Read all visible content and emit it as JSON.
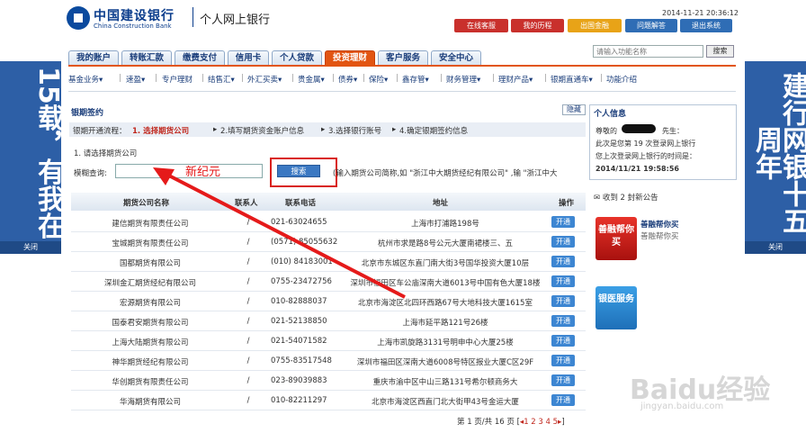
{
  "left_banner": {
    "text": "15载，有我在",
    "close": "关闭"
  },
  "right_banner": {
    "text": "建行网银十五周年",
    "close": "关闭"
  },
  "header": {
    "logo_cn": "中国建设银行",
    "logo_en": "China Construction Bank",
    "product": "个人网上银行",
    "datetime": "2014-11-21 20:36:12",
    "buttons": [
      "在线客服",
      "我的历程",
      "出国金融",
      "问题解答",
      "退出系统"
    ]
  },
  "tabs": [
    "我的账户",
    "转账汇款",
    "缴费支付",
    "信用卡",
    "个人贷款",
    "投资理财",
    "客户服务",
    "安全中心"
  ],
  "active_tab": "投资理财",
  "search": {
    "placeholder": "请输入功能名称",
    "button": "搜索"
  },
  "subnav": [
    "基金业务▾",
    "速盈▾",
    "专户理财",
    "结售汇▾",
    "外汇买卖▾",
    "贵金属▾",
    "债券▾",
    "保险▾",
    "鑫存管▾",
    "财务管理▾",
    "理财产品▾",
    "银期直通车▾",
    "功能介绍"
  ],
  "section_title": "银期签约",
  "hide_label": "隐藏",
  "steps": {
    "prefix": "银期开通流程：",
    "items": [
      "1. 选择期货公司",
      "2.填写期货资金账户信息",
      "3.选择银行账号",
      "4.确定银期签约信息"
    ]
  },
  "step1_title": "1. 请选择期货公司",
  "fuzzy": {
    "label": "模糊查询:",
    "button": "搜索",
    "hint": "(输入期货公司简称,如 \"浙江中大期货经纪有限公司\" ,输 \"浙江中大"
  },
  "annotation": "新纪元",
  "table": {
    "headers": [
      "期货公司名称",
      "联系人",
      "联系电话",
      "地址",
      "操作"
    ],
    "rows": [
      {
        "name": "建信期货有限责任公司",
        "contact": "/",
        "phone": "021-63024655",
        "address": "上海市打浦路198号",
        "action": "开通"
      },
      {
        "name": "宝城期货有限责任公司",
        "contact": "/",
        "phone": "(0571) 85055632",
        "address": "杭州市求是路8号公元大厦南裙楼三、五",
        "action": "开通"
      },
      {
        "name": "国都期货有限公司",
        "contact": "/",
        "phone": "(010) 84183001",
        "address": "北京市东城区东直门南大街3号国华投资大厦10层",
        "action": "开通"
      },
      {
        "name": "深圳金汇期货经纪有限公司",
        "contact": "/",
        "phone": "0755-23472756",
        "address": "深圳市福田区车公庙深南大道6013号中国有色大厦18楼",
        "action": "开通"
      },
      {
        "name": "宏源期货有限公司",
        "contact": "/",
        "phone": "010-82888037",
        "address": "北京市海淀区北四环西路67号大地科技大厦1615室",
        "action": "开通"
      },
      {
        "name": "国泰君安期货有限公司",
        "contact": "/",
        "phone": "021-52138850",
        "address": "上海市延平路121号26楼",
        "action": "开通"
      },
      {
        "name": "上海大陆期货有限公司",
        "contact": "/",
        "phone": "021-54071582",
        "address": "上海市凯旋路3131号明申中心大厦25楼",
        "action": "开通"
      },
      {
        "name": "神华期货经纪有限公司",
        "contact": "/",
        "phone": "0755-83517548",
        "address": "深圳市福田区深南大道6008号特区报业大厦C区29F",
        "action": "开通"
      },
      {
        "name": "华创期货有限责任公司",
        "contact": "/",
        "phone": "023-89039883",
        "address": "重庆市渝中区中山三路131号希尔顿商务大",
        "action": "开通"
      },
      {
        "name": "华海期货有限公司",
        "contact": "/",
        "phone": "010-82211297",
        "address": "北京市海淀区西直门北大街甲43号金运大厦",
        "action": "开通"
      }
    ]
  },
  "pager": {
    "prefix": "第 1 页/共 16 页 [",
    "pages": "◂1 2 3 4 5▸",
    "suffix": "]"
  },
  "right_panel": {
    "title": "个人信息",
    "greeting": "尊敬的",
    "salutation": "先生：",
    "login_count": "此次是您第 19 次登录网上银行",
    "last_login_label": "您上次登录网上银行的时间是：",
    "last_login": "2014/11/21 19:58:56",
    "messages": "收到 2 封新公告",
    "promo1_link": "善融帮你买",
    "promo1_sub": "善融帮你买",
    "promo1_img": "善融帮你买",
    "promo2_img": "银医服务"
  },
  "watermark": {
    "main": "Baidu经验",
    "sub": "jingyan.baidu.com"
  }
}
